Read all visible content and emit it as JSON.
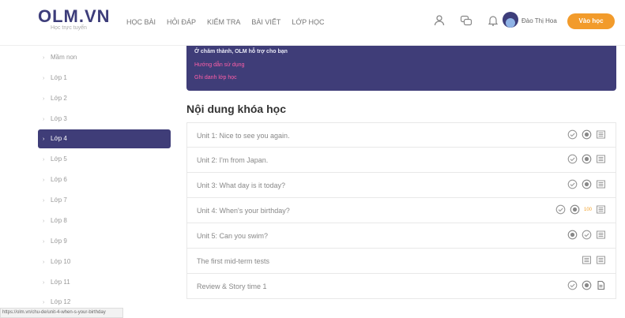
{
  "header": {
    "logo_main": "OLM.VN",
    "logo_sub": "Học trực tuyến",
    "nav": [
      "HỌC BÀI",
      "HỎI ĐÁP",
      "KIỂM TRA",
      "BÀI VIẾT",
      "LỚP HỌC"
    ],
    "username": "Đào Thị Hoa",
    "join_label": "Vào học"
  },
  "sidebar": {
    "items": [
      {
        "label": "Mầm non"
      },
      {
        "label": "Lớp 1"
      },
      {
        "label": "Lớp 2"
      },
      {
        "label": "Lớp 3"
      },
      {
        "label": "Lớp 4",
        "active": true
      },
      {
        "label": "Lớp 5"
      },
      {
        "label": "Lớp 6"
      },
      {
        "label": "Lớp 7"
      },
      {
        "label": "Lớp 8"
      },
      {
        "label": "Lớp 9"
      },
      {
        "label": "Lớp 10"
      },
      {
        "label": "Lớp 11"
      },
      {
        "label": "Lớp 12"
      }
    ],
    "status_url": "https://olm.vn/chu-de/unit-4-when-s-your-birthday"
  },
  "banner": {
    "line1": "Ở chăm thành, OLM hỗ trợ cho bạn",
    "link1": "Hướng dẫn sử dụng",
    "link2": "Ghi danh lớp học"
  },
  "main": {
    "section_title": "Nội dung khóa học",
    "units": [
      {
        "label": "Unit 1: Nice to see you again.",
        "icons": [
          "check-circle-icon",
          "target-icon",
          "list-icon"
        ],
        "score": ""
      },
      {
        "label": "Unit 2: I'm from Japan.",
        "icons": [
          "check-circle-icon",
          "target-icon",
          "list-icon"
        ],
        "score": ""
      },
      {
        "label": "Unit 3: What day is it today?",
        "icons": [
          "check-circle-icon",
          "target-icon",
          "list-icon"
        ],
        "score": ""
      },
      {
        "label": "Unit 4: When's your birthday?",
        "icons": [
          "check-circle-icon",
          "target-icon",
          "list-icon"
        ],
        "score": "100"
      },
      {
        "label": "Unit 5: Can you swim?",
        "icons": [
          "target-icon",
          "check-circle-icon",
          "list-icon"
        ],
        "score": ""
      },
      {
        "label": "The first mid-term tests",
        "icons": [
          "list-icon",
          "list-icon"
        ],
        "score": ""
      },
      {
        "label": "Review & Story time 1",
        "icons": [
          "check-circle-icon",
          "target-icon",
          "document-icon"
        ],
        "score": ""
      }
    ]
  },
  "colors": {
    "accent": "#3f3d78",
    "orange": "#f29b2b",
    "pink_link": "#ff5fa8"
  }
}
